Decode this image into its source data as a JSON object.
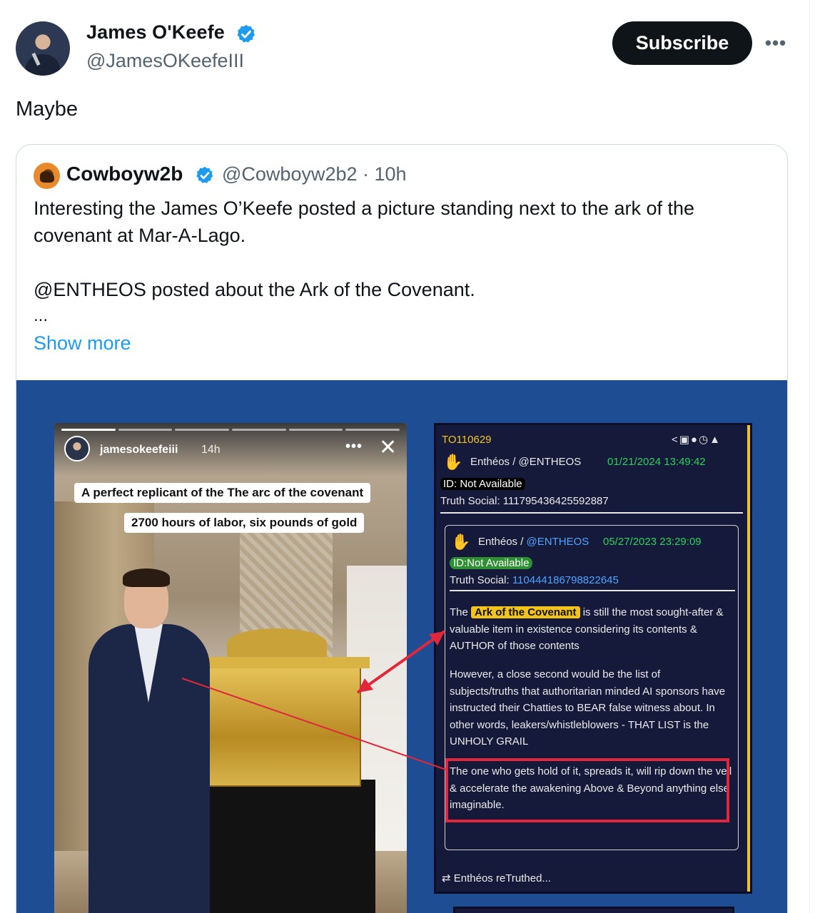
{
  "author": {
    "name": "James O'Keefe",
    "handle": "@JamesOKeefeIII",
    "verified_icon": "verified-badge-icon"
  },
  "actions": {
    "subscribe_label": "Subscribe",
    "more_icon": "more-options-icon"
  },
  "post": {
    "text": "Maybe"
  },
  "quoted": {
    "name": "Cowboyw2b",
    "handle_time": "@Cowboyw2b2 · 10h",
    "body": [
      "Interesting the James O’Keefe posted a picture standing next to the ark of the covenant at Mar-A-Lago.",
      "",
      "@ENTHEOS posted about the Ark of the Covenant."
    ],
    "ellipsis": "...",
    "show_more": "Show more"
  },
  "story": {
    "username": "jamesokeefeiii",
    "time": "14h",
    "caption1": "A perfect replicant of the The arc of the covenant",
    "caption2": "2700 hours of labor, six pounds of gold"
  },
  "truth": {
    "post_id": "TO110629",
    "user1": "Enthéos / @ENTHEOS",
    "date1": "01/21/2024 13:49:42",
    "id_badge1": "ID: Not Available",
    "truth_social1": "Truth Social: 111795436425592887",
    "user2_name": "Enthéos / ",
    "user2_handle": "@ENTHEOS",
    "date2": "05/27/2023 23:29:09",
    "id_badge2": "ID:Not Available",
    "truth_social2_label": "Truth Social: ",
    "truth_social2_value": "110444186798822645",
    "para1_pre": "The",
    "para1_highlight": "Ark of the Covenant",
    "para1_post": "is still the most sought-after & valuable item in existence considering its contents & AUTHOR of those contents",
    "para2": "However, a close second would be the list of subjects/truths that authoritarian minded AI sponsors have instructed their Chatties to BEAR false witness about.  In other words, leakers/whistleblowers - THAT LIST is the UNHOLY GRAIL",
    "para3": "The one who gets hold of it, spreads it, will rip down the veil & accelerate the awakening Above & Beyond anything else imaginable.",
    "retruth": "Enthéos  reTruthed...",
    "retruth_icon": "retruth-icon"
  },
  "colors": {
    "accent": "#1d9bf0",
    "media_bg": "#1f4d93",
    "truth_bg": "#161a3a",
    "truth_gold": "#f2c31b",
    "truth_green": "#2bd15a",
    "annotation_red": "#e0273b"
  }
}
